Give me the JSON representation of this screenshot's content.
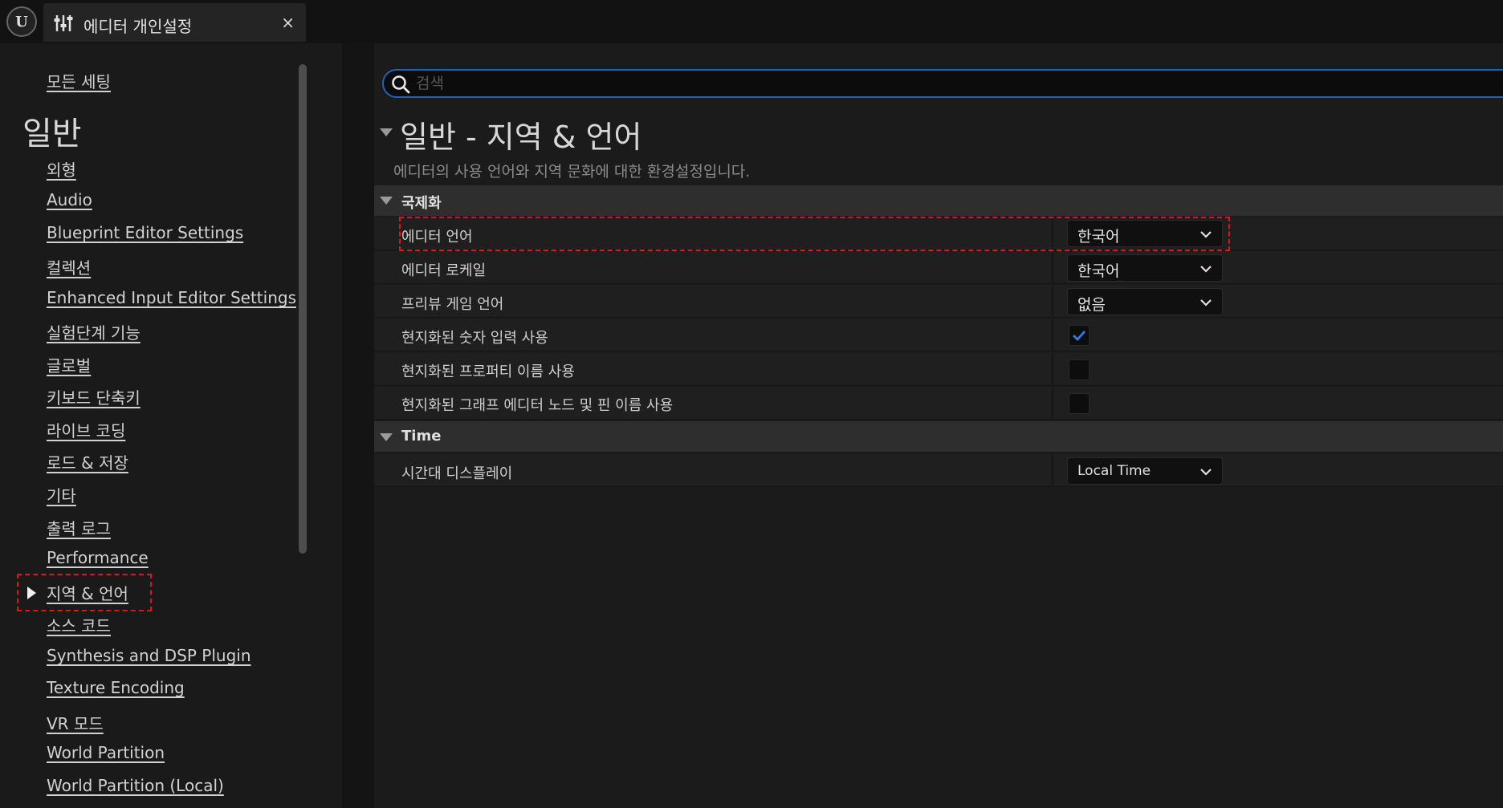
{
  "window": {
    "tab_title": "에디터 개인설정",
    "close_glyph": "×",
    "logo_glyph": "U"
  },
  "sidebar": {
    "all_settings": "모든 세팅",
    "section_heading": "일반",
    "items": [
      {
        "label": "외형"
      },
      {
        "label": "Audio"
      },
      {
        "label": "Blueprint Editor Settings"
      },
      {
        "label": "컬렉션"
      },
      {
        "label": "Enhanced Input Editor Settings"
      },
      {
        "label": "실험단계 기능"
      },
      {
        "label": "글로벌"
      },
      {
        "label": "키보드 단축키"
      },
      {
        "label": "라이브 코딩"
      },
      {
        "label": "로드 & 저장"
      },
      {
        "label": "기타"
      },
      {
        "label": "출력 로그"
      },
      {
        "label": "Performance"
      },
      {
        "label": "지역 & 언어",
        "selected": true
      },
      {
        "label": "소스 코드"
      },
      {
        "label": "Synthesis and DSP Plugin"
      },
      {
        "label": "Texture Encoding"
      },
      {
        "label": "VR 모드"
      },
      {
        "label": "World Partition"
      },
      {
        "label": "World Partition (Local)"
      }
    ]
  },
  "search": {
    "placeholder": "검색",
    "value": ""
  },
  "main": {
    "title": "일반 - 지역 & 언어",
    "description": "에디터의 사용 언어와 지역 문화에 대한 환경설정입니다.",
    "categories": [
      {
        "label": "국제화",
        "properties": [
          {
            "label": "에디터 언어",
            "type": "combo",
            "value": "한국어"
          },
          {
            "label": "에디터 로케일",
            "type": "combo",
            "value": "한국어"
          },
          {
            "label": "프리뷰 게임 언어",
            "type": "combo",
            "value": "없음"
          },
          {
            "label": "현지화된 숫자 입력 사용",
            "type": "checkbox",
            "checked": true
          },
          {
            "label": "현지화된 프로퍼티 이름 사용",
            "type": "checkbox",
            "checked": false
          },
          {
            "label": "현지화된 그래프 에디터 노드 및 핀 이름 사용",
            "type": "checkbox",
            "checked": false
          }
        ]
      },
      {
        "label": "Time",
        "properties": [
          {
            "label": "시간대 디스플레이",
            "type": "combo",
            "value": "Local Time"
          }
        ]
      }
    ]
  },
  "colors": {
    "accent": "#1f63b8",
    "highlight": "#e0141c",
    "check": "#2f7de1"
  }
}
